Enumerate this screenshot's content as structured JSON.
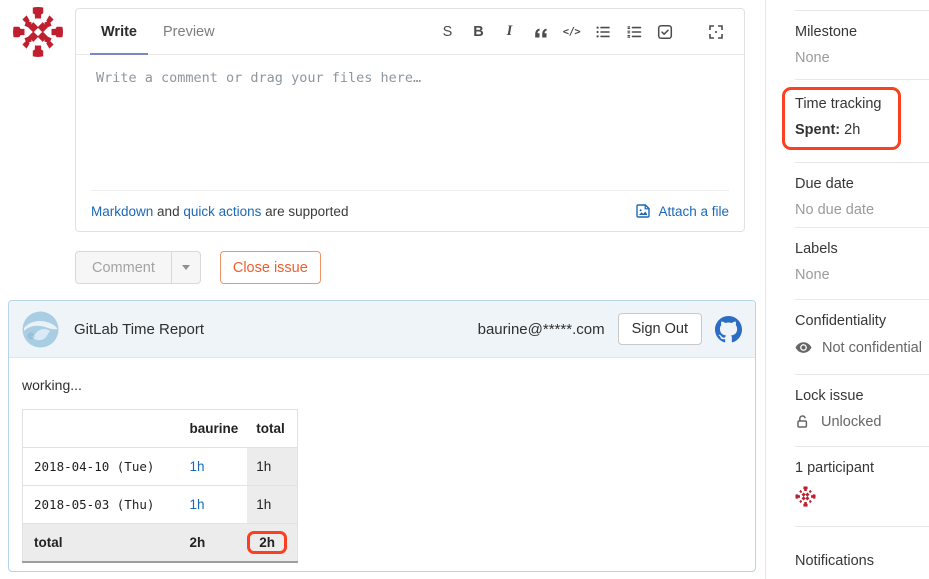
{
  "editor": {
    "tabs": {
      "write": "Write",
      "preview": "Preview"
    },
    "placeholder": "Write a comment or drag your files here…",
    "toolbar": {
      "strike_label": "S",
      "bold_label": "B",
      "italic_label": "I",
      "code_label": "</>"
    },
    "footer": {
      "markdown_link": "Markdown",
      "and_text": " and ",
      "quick_actions_link": "quick actions",
      "supported_text": " are supported",
      "attach_label": "Attach a file"
    }
  },
  "actions": {
    "comment_label": "Comment",
    "close_issue_label": "Close issue"
  },
  "report": {
    "title": "GitLab Time Report",
    "email": "baurine@*****.com",
    "sign_out_label": "Sign Out",
    "status_text": "working...",
    "table": {
      "col_user": "baurine",
      "col_total": "total",
      "rows": [
        {
          "label": "2018-04-10 (Tue)",
          "user_hours": "1h",
          "total_hours": "1h"
        },
        {
          "label": "2018-05-03 (Thu)",
          "user_hours": "1h",
          "total_hours": "1h"
        },
        {
          "label": "total",
          "user_hours": "2h",
          "total_hours": "2h"
        }
      ]
    }
  },
  "sidebar": {
    "milestone": {
      "title": "Milestone",
      "value": "None"
    },
    "time_tracking": {
      "title": "Time tracking",
      "spent_label": "Spent:",
      "spent_value": " 2h"
    },
    "due_date": {
      "title": "Due date",
      "value": "No due date"
    },
    "labels": {
      "title": "Labels",
      "value": "None"
    },
    "confidentiality": {
      "title": "Confidentiality",
      "value": "Not confidential"
    },
    "lock": {
      "title": "Lock issue",
      "value": "Unlocked"
    },
    "participants": {
      "title": "1 participant"
    },
    "notifications": {
      "title": "Notifications"
    }
  },
  "colors": {
    "annotation_red": "#fb4021",
    "link_blue": "#1b69b6",
    "close_orange": "#ee5f2e",
    "tab_underline": "#7b87c6",
    "github_blue": "#2b6cc4",
    "panel_border_blue": "#b6d5e7",
    "table_shaded": "#ececec"
  }
}
